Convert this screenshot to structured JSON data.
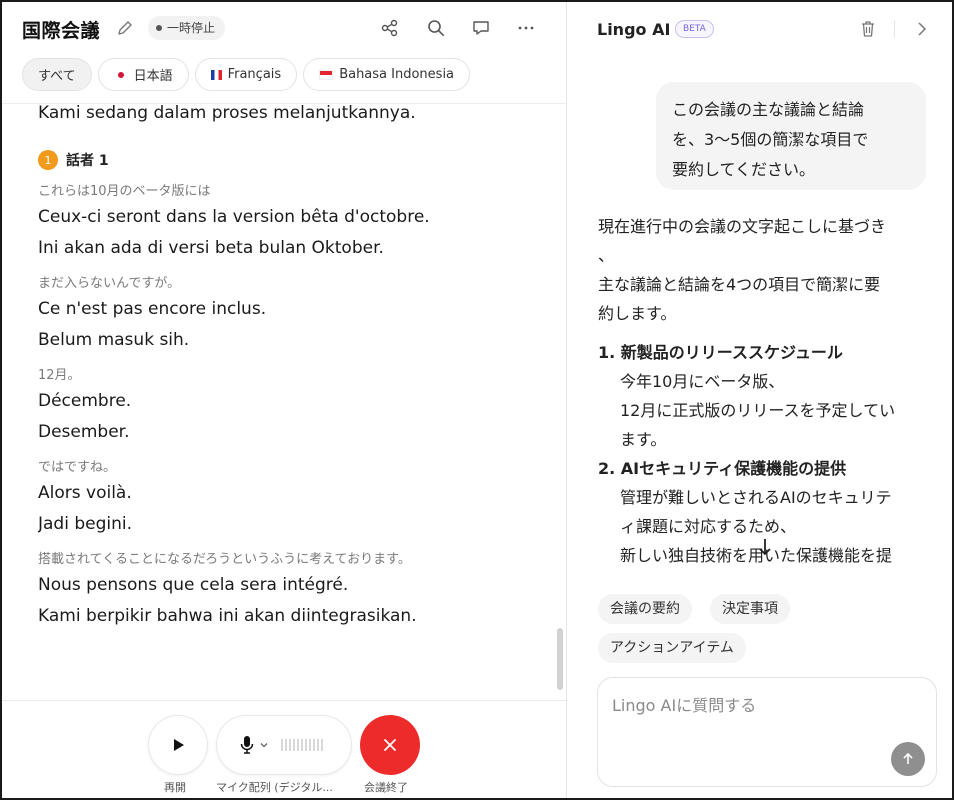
{
  "header": {
    "meeting_title": "国際会議",
    "status_badge": "一時停止"
  },
  "language_tabs": [
    {
      "label": "すべて",
      "flag": ""
    },
    {
      "label": "日本語",
      "flag": "jp"
    },
    {
      "label": "Français",
      "flag": "fr"
    },
    {
      "label": "Bahasa Indonesia",
      "flag": "id"
    }
  ],
  "transcript": {
    "top_line": "Kami sedang dalam proses melanjutkannya.",
    "speaker": {
      "number": "1",
      "name": "話者 1"
    },
    "segments": [
      {
        "source": "これらは10月のベータ版には",
        "fr": "Ceux-ci seront dans la version bêta d'octobre.",
        "id": "Ini akan ada di versi beta bulan Oktober."
      },
      {
        "source": "まだ入らないんですが。",
        "fr": "Ce n'est pas encore inclus.",
        "id": "Belum masuk sih."
      },
      {
        "source": "12月。",
        "fr": "Décembre.",
        "id": "Desember."
      },
      {
        "source": "ではですね。",
        "fr": "Alors voilà.",
        "id": "Jadi begini."
      },
      {
        "source": "搭載されてくることになるだろうというふうに考えております。",
        "fr": "Nous pensons que cela sera intégré.",
        "id": "Kami berpikir bahwa ini akan diintegrasikan."
      }
    ]
  },
  "controls": {
    "play_label": "再開",
    "mic_label": "マイク配列 (デジタル...",
    "end_label": "会議終了"
  },
  "assistant": {
    "title": "Lingo AI",
    "beta": "BETA",
    "user_message": [
      "この会議の主な議論と結論",
      "を、3〜5個の簡潔な項目で",
      "要約してください。"
    ],
    "answer_intro": [
      "現在進行中の会議の文字起こしに基づき",
      "、",
      "主な議論と結論を4つの項目で簡潔に要",
      "約します。"
    ],
    "answer_items": [
      {
        "head": "1. 新製品のリリーススケジュール",
        "body": [
          "今年10月にベータ版、",
          "12月に正式版のリリースを予定してい",
          "ます。"
        ]
      },
      {
        "head": "2. AIセキュリティ保護機能の提供",
        "body": [
          "管理が難しいとされるAIのセキュリテ",
          "ィ課題に対応するため、",
          "新しい独自技術を用いた保護機能を提"
        ]
      }
    ],
    "chips": [
      "会議の要約",
      "決定事項",
      "アクションアイテム"
    ],
    "input_placeholder": "Lingo AIに質問する"
  },
  "icons": {
    "edit": "pencil-icon",
    "share": "share-icon",
    "search": "search-icon",
    "comment": "comment-icon",
    "more": "more-icon",
    "trash": "trash-icon",
    "collapse": "chevron-right-icon",
    "play": "play-icon",
    "mic": "mic-icon",
    "end": "close-icon",
    "send": "arrow-up-icon",
    "scroll": "arrow-down-icon"
  },
  "colors": {
    "end_button": "#ee2b2b",
    "speaker_badge": "#f29a1b",
    "beta_badge": "#7a66d6"
  }
}
